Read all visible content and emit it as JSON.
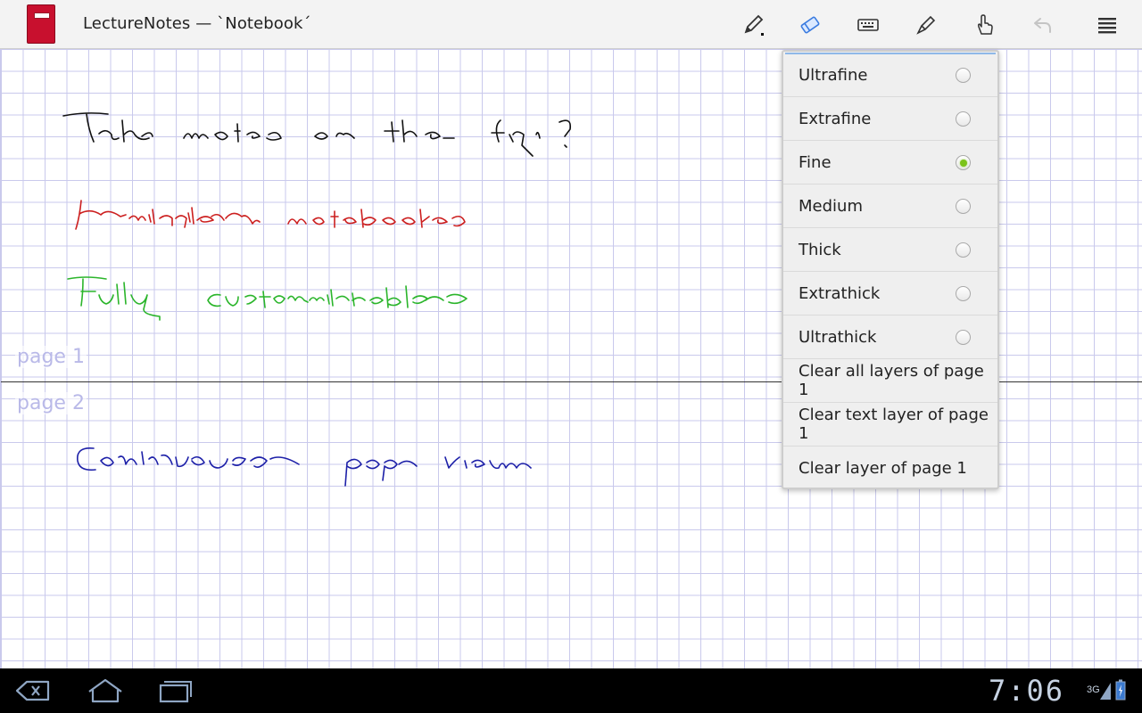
{
  "app": {
    "title": "LectureNotes — `Notebook´"
  },
  "toolbar": {
    "icons": [
      "pen-icon",
      "eraser-icon",
      "keyboard-icon",
      "highlighter-icon",
      "hand-icon",
      "undo-icon",
      "overflow-menu-icon"
    ],
    "active_tool": "eraser-icon"
  },
  "notebook": {
    "pages": [
      {
        "label": "page 1",
        "lines": [
          {
            "text": "Take notes on the fly!",
            "color": "#111111"
          },
          {
            "text": "Multiple notebooks",
            "color": "#cc1f1f"
          },
          {
            "text": "Fully customizable",
            "color": "#2bb52b"
          }
        ]
      },
      {
        "label": "page 2",
        "lines": [
          {
            "text": "Continuous page view",
            "color": "#1c1fa8"
          }
        ]
      }
    ],
    "grid_color": "#c9c9ec"
  },
  "popup_menu": {
    "items": [
      {
        "label": "Ultrafine",
        "type": "radio",
        "checked": false
      },
      {
        "label": "Extrafine",
        "type": "radio",
        "checked": false
      },
      {
        "label": "Fine",
        "type": "radio",
        "checked": true
      },
      {
        "label": "Medium",
        "type": "radio",
        "checked": false
      },
      {
        "label": "Thick",
        "type": "radio",
        "checked": false
      },
      {
        "label": "Extrathick",
        "type": "radio",
        "checked": false
      },
      {
        "label": "Ultrathick",
        "type": "radio",
        "checked": false
      },
      {
        "label": "Clear all layers of page 1",
        "type": "action"
      },
      {
        "label": "Clear text layer of page 1",
        "type": "action"
      },
      {
        "label": "Clear layer of page 1",
        "type": "action"
      }
    ],
    "accent": "#7bc31a"
  },
  "system_bar": {
    "time": "7:06",
    "network": "3G",
    "nav_icons": [
      "back-icon",
      "home-icon",
      "recent-apps-icon"
    ]
  }
}
